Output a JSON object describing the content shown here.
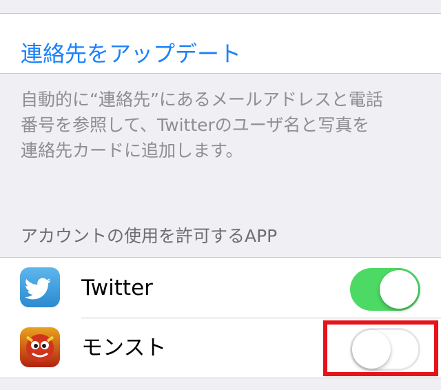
{
  "update_contacts": {
    "label": "連絡先をアップデート"
  },
  "footer": {
    "lines": [
      "自動的に“連絡先”にあるメールアドレスと電話",
      "番号を参照して、Twitterのユーザ名と写真を",
      "連絡先カードに追加します。"
    ]
  },
  "allowed_apps": {
    "header": "アカウントの使用を許可するAPP",
    "items": [
      {
        "name": "Twitter",
        "icon": "twitter-bird-icon",
        "enabled": true
      },
      {
        "name": "モンスト",
        "icon": "monster-strike-icon",
        "enabled": false
      }
    ]
  },
  "colors": {
    "accent": "#1a82fb",
    "toggle_on": "#4cd964",
    "highlight": "#e4141b",
    "background": "#efeff4"
  }
}
